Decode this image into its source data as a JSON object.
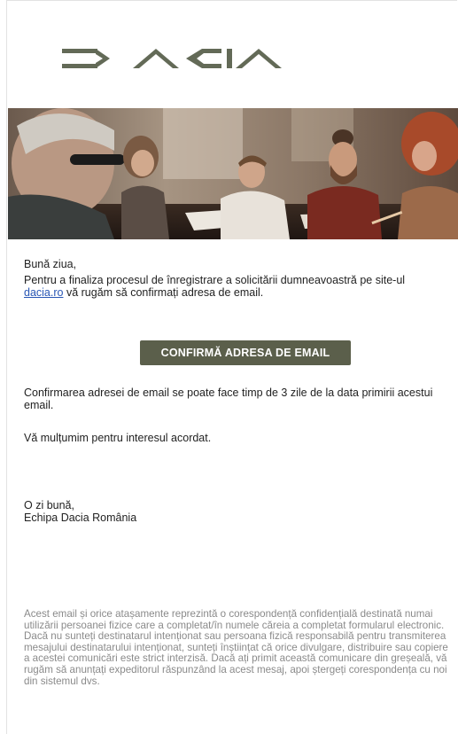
{
  "brand": {
    "logo_text": "DACIA",
    "logo_color": "#636a57"
  },
  "email": {
    "greeting": "Bună ziua,",
    "intro_text": "Pentru a finaliza procesul de înregistrare a solicitării dumneavoastră pe site-ul",
    "site_link": "dacia.ro",
    "intro_suffix": " vă rugăm să confirmați adresa de email.",
    "cta_label": "CONFIRMĂ ADRESA DE EMAIL",
    "validity_text": "Confirmarea adresei de email se poate face timp de 3 zile de la data primirii acestui email.",
    "thanks_text": "Vă mulțumim pentru interesul acordat.",
    "signoff_line1": "O zi bună,",
    "signoff_line2": "Echipa Dacia România",
    "disclaimer": "Acest email și orice atașamente reprezintă o corespondență confidențială destinată numai utilizării persoanei fizice care a completat/în numele căreia a completat formularul electronic. Dacă nu sunteți destinatarul intenționat sau persoana fizică responsabilă pentru transmiterea mesajului destinatarului intenționat, sunteți înștiințat că orice divulgare, distribuire sau copiere a acestei comunicări este strict interzisă. Dacă ați primit această comunicare din greșeală, vă rugăm să anunțați expeditorul răspunzând la acest mesaj, apoi ștergeți corespondența cu noi din sistemul dvs."
  },
  "colors": {
    "cta_background": "#5b5f4b",
    "link": "#2a57b5",
    "disclaimer_text": "#8a8a8a"
  }
}
